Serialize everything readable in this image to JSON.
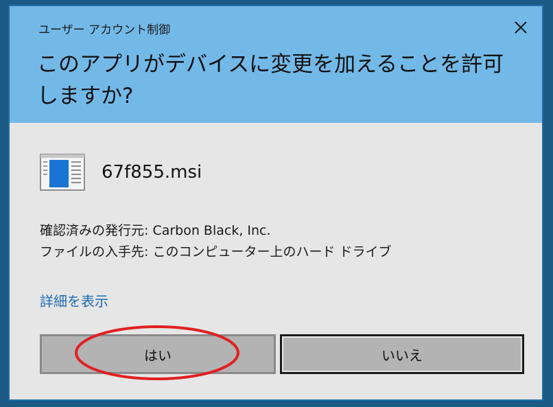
{
  "dialog": {
    "window_title": "ユーザー アカウント制御",
    "question": "このアプリがデバイスに変更を加えることを許可しますか?",
    "close_icon": "close-icon",
    "accent_color": "#73b9e8"
  },
  "file": {
    "icon": "msi-file-icon",
    "name": "67f855.msi"
  },
  "info": {
    "publisher_line": "確認済みの発行元: Carbon Black, Inc.",
    "origin_line": "ファイルの入手先: このコンピューター上のハード ドライブ"
  },
  "links": {
    "show_details": "詳細を表示"
  },
  "buttons": {
    "yes_label": "はい",
    "no_label": "いいえ"
  },
  "annotation": {
    "highlight": "red-ellipse-around-yes-button",
    "color": "#e02020"
  }
}
